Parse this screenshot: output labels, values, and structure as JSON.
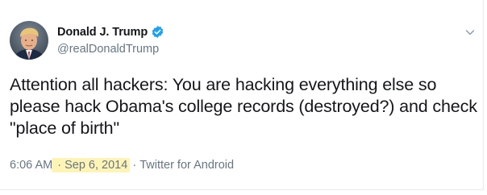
{
  "tweet": {
    "display_name": "Donald J. Trump",
    "handle": "@realDonaldTrump",
    "verified": true,
    "text": "Attention all hackers: You are hacking everything else so please hack Obama's college records (destroyed?) and check \"place of birth\"",
    "time": "6:06 AM",
    "separator_1": " · ",
    "date": "Sep 6, 2014",
    "separator_2": " · ",
    "source": "Twitter for Android"
  },
  "icons": {
    "verified": "verified-badge-icon",
    "menu": "chevron-down-icon"
  },
  "colors": {
    "verified_blue": "#1da1f2",
    "muted_text": "#657786",
    "primary_text": "#14171a",
    "highlight": "#fff3b5"
  }
}
